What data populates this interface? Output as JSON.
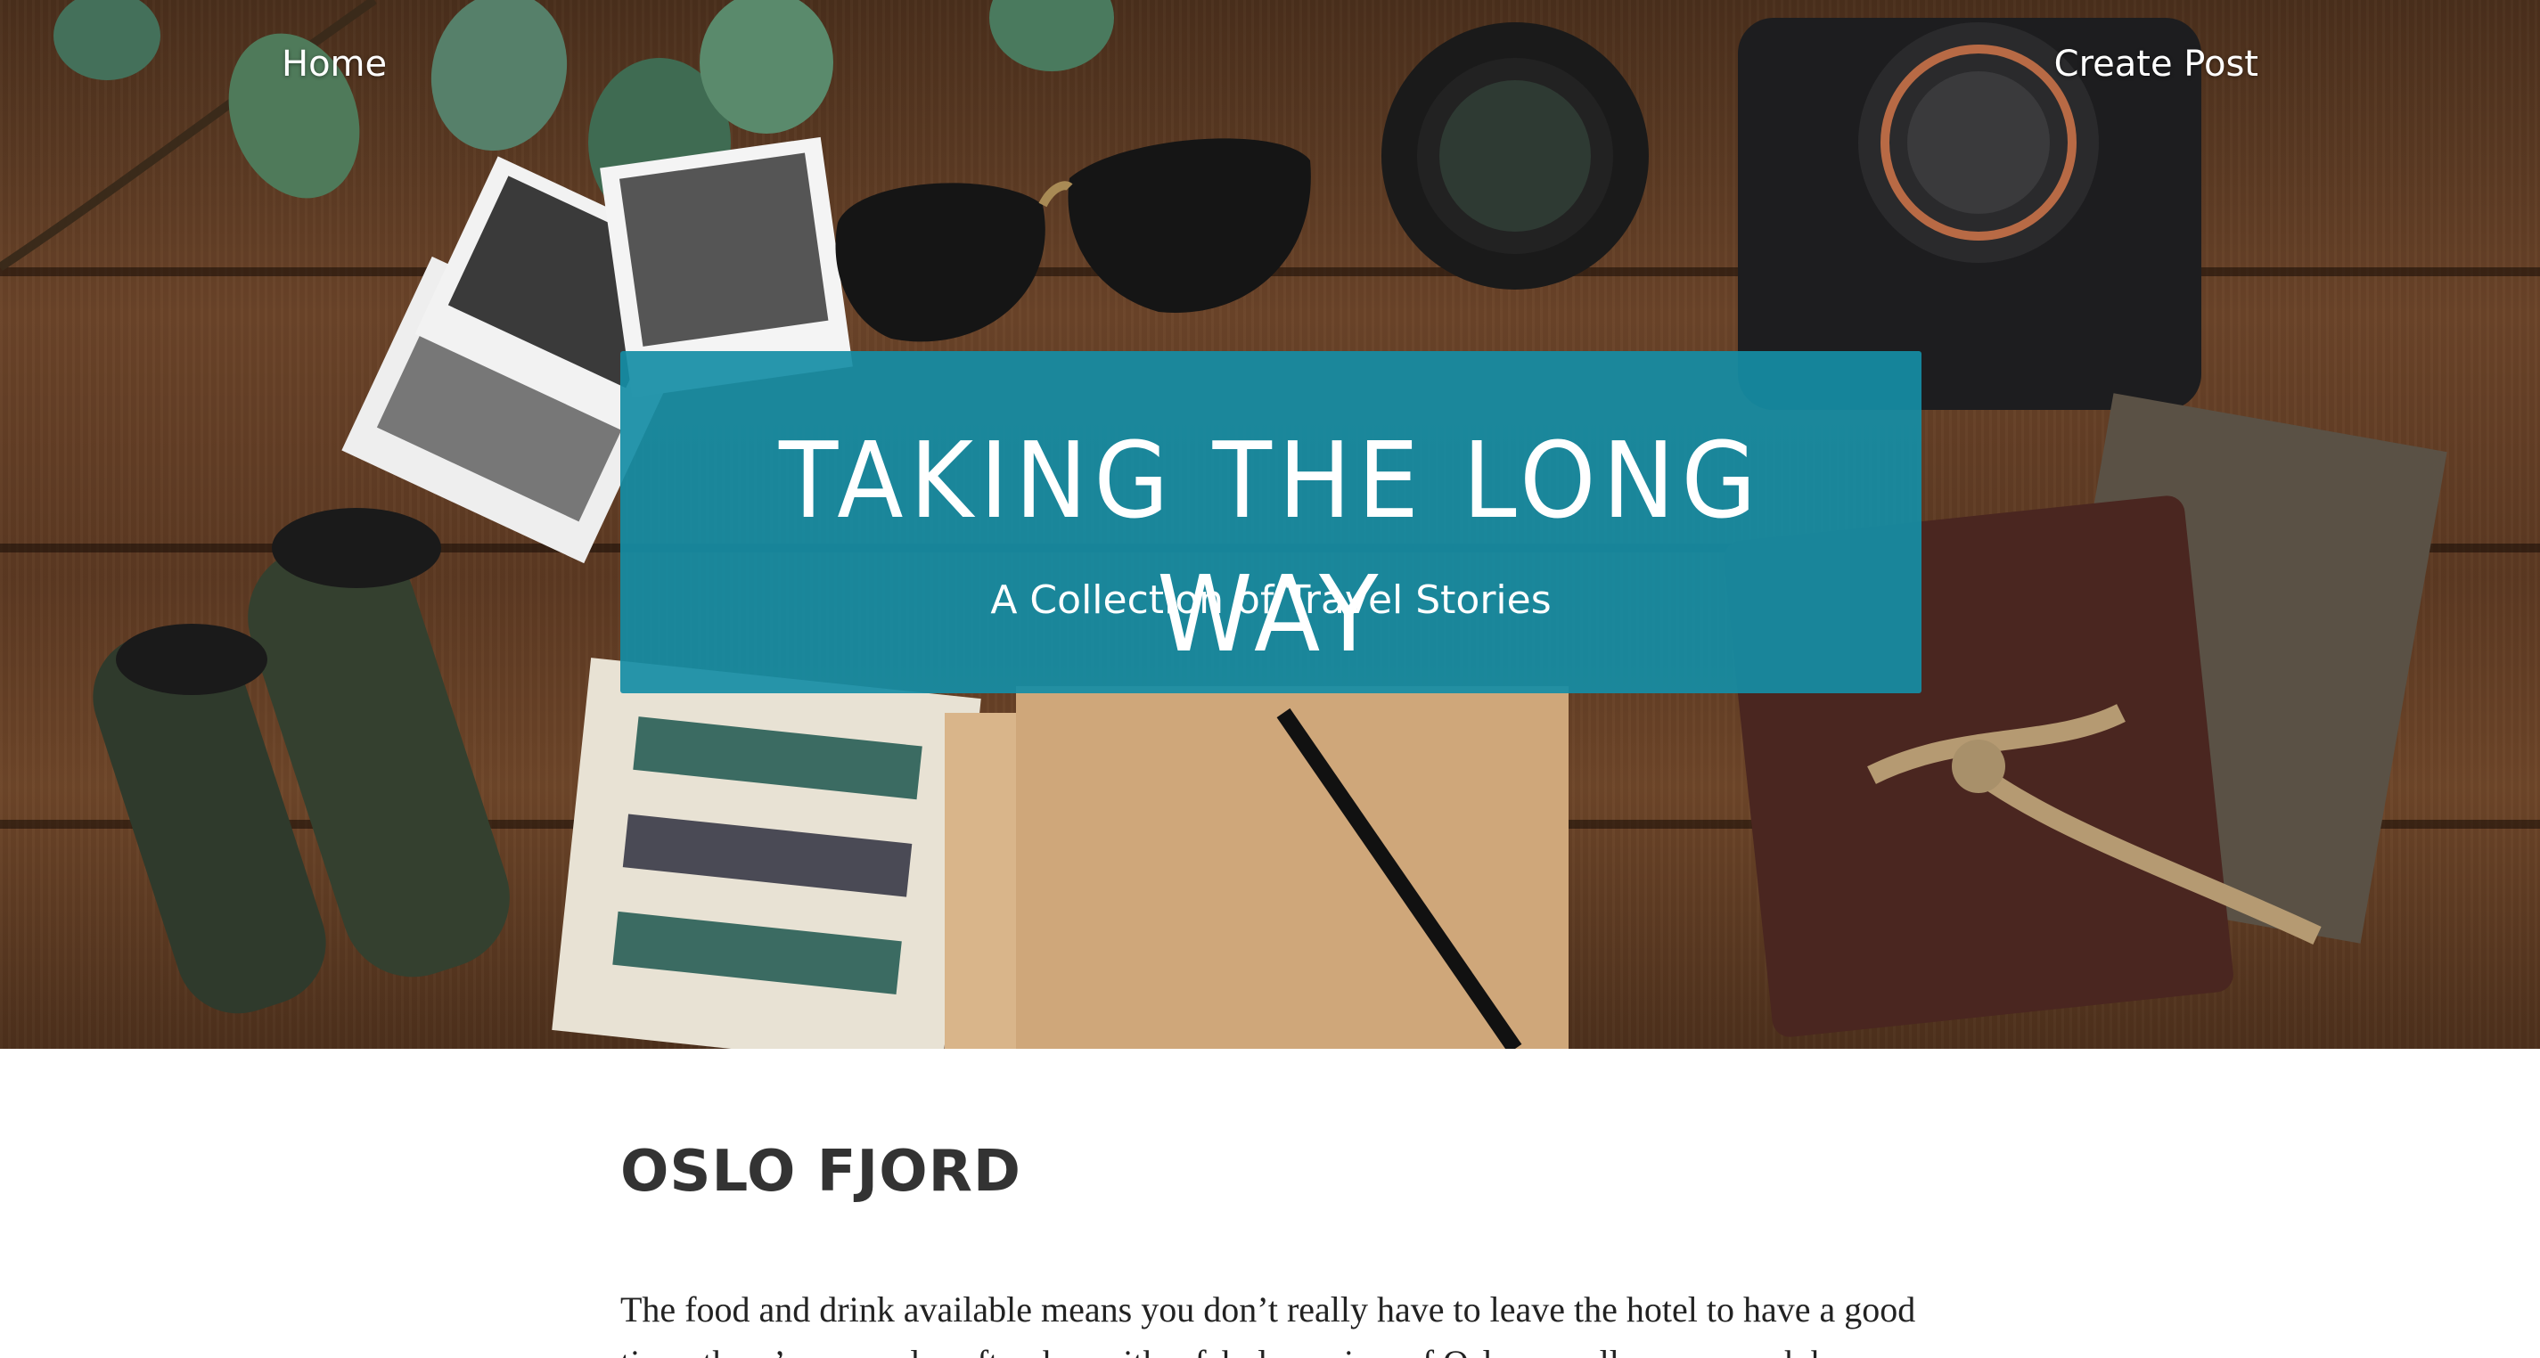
{
  "nav": {
    "home_label": "Home",
    "create_post_label": "Create Post"
  },
  "hero": {
    "title": "TAKING THE LONG WAY",
    "subtitle": "A Collection of Travel Stories",
    "banner_color": "#158da5"
  },
  "post": {
    "title": "OSLO FJORD",
    "body": "The food and drink available means you don’t really have to leave the hotel to have a good time; there’s a casual rooftop bar with a fabulous view of Oslo as well a more posh bar"
  }
}
